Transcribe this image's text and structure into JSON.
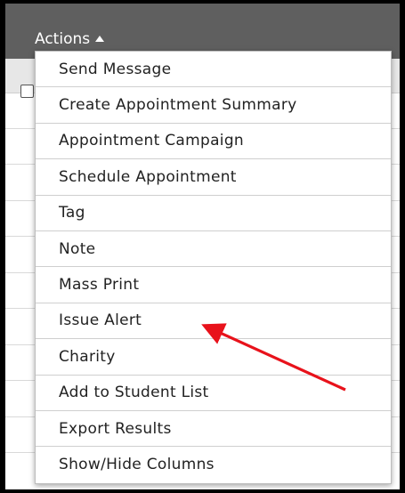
{
  "header": {
    "actions_label": "Actions"
  },
  "menu": {
    "items": [
      {
        "label": "Send Message"
      },
      {
        "label": "Create Appointment Summary"
      },
      {
        "label": "Appointment Campaign"
      },
      {
        "label": "Schedule Appointment"
      },
      {
        "label": "Tag"
      },
      {
        "label": "Note"
      },
      {
        "label": "Mass Print"
      },
      {
        "label": "Issue Alert"
      },
      {
        "label": "Charity"
      },
      {
        "label": "Add to Student List"
      },
      {
        "label": "Export Results"
      },
      {
        "label": "Show/Hide Columns"
      }
    ]
  },
  "annotation": {
    "arrow_color": "#e8121b",
    "points_to": "Issue Alert"
  },
  "colors": {
    "header_bg": "#5f5f5f",
    "menu_bg": "#ffffff",
    "outer_frame": "#000000"
  }
}
